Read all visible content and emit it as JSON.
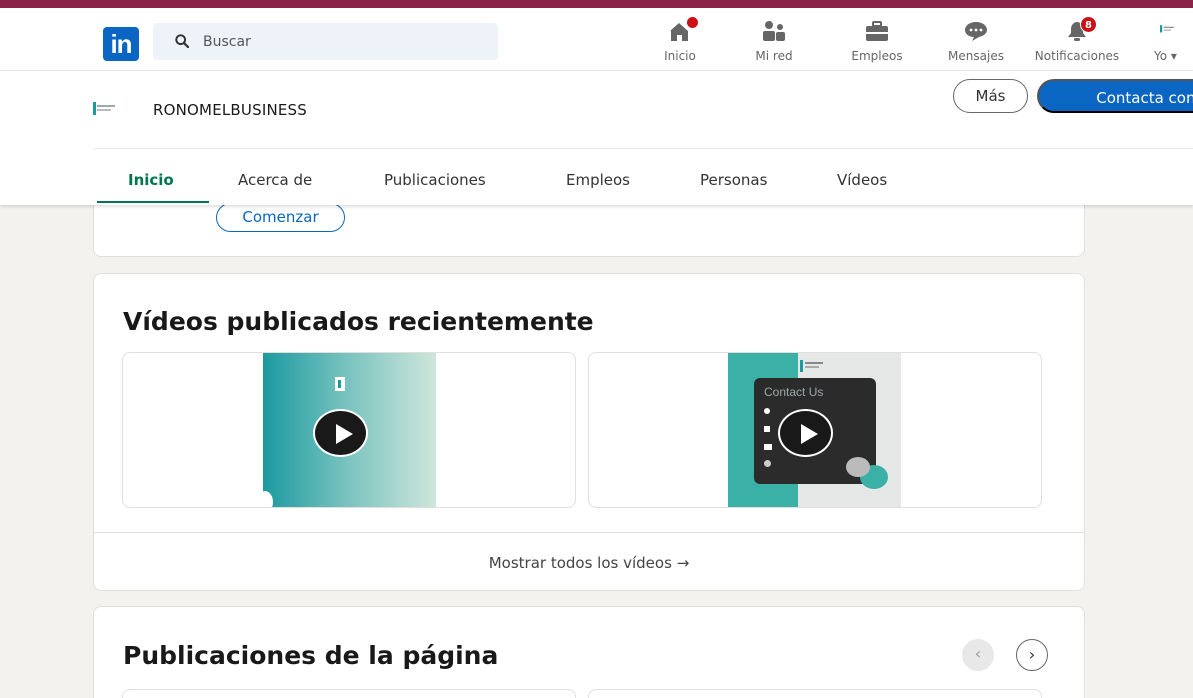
{
  "nav": {
    "search_placeholder": "Buscar",
    "items": [
      {
        "label": "Inicio",
        "icon": "home-icon"
      },
      {
        "label": "Mi red",
        "icon": "network-icon"
      },
      {
        "label": "Empleos",
        "icon": "briefcase-icon"
      },
      {
        "label": "Mensajes",
        "icon": "messaging-icon"
      },
      {
        "label": "Notificaciones",
        "icon": "bell-icon",
        "badge": "8"
      },
      {
        "label": "Yo",
        "icon": "profile-avatar"
      }
    ],
    "logo_text": "in"
  },
  "company": {
    "name": "RONOMELBUSINESS",
    "more_label": "Más",
    "contact_label": "Contacta con n"
  },
  "tabs": [
    {
      "label": "Inicio",
      "active": true
    },
    {
      "label": "Acerca de"
    },
    {
      "label": "Publicaciones"
    },
    {
      "label": "Empleos"
    },
    {
      "label": "Personas"
    },
    {
      "label": "Vídeos"
    }
  ],
  "start_card": {
    "button_label": "Comenzar"
  },
  "videos": {
    "title": "Vídeos publicados recientemente",
    "show_all_label": "Mostrar todos los vídeos",
    "video2_overlay_text": "Contact Us"
  },
  "posts": {
    "title": "Publicaciones de la página"
  },
  "colors": {
    "brand": "#0a66c2",
    "active_tab": "#01754f",
    "badge": "#cc1016",
    "top_stripe": "#8c2348"
  }
}
